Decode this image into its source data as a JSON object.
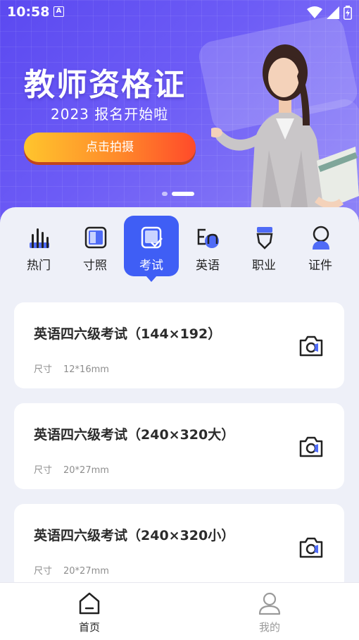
{
  "status": {
    "time": "10:58",
    "badge": "A"
  },
  "banner": {
    "title": "教师资格证",
    "subtitle": "2023 报名开始啦",
    "button": "点击拍摄"
  },
  "categories": [
    {
      "label": "热门",
      "icon": "bar-chart-icon",
      "active": false
    },
    {
      "label": "寸照",
      "icon": "photo-frame-icon",
      "active": false
    },
    {
      "label": "考试",
      "icon": "exam-check-icon",
      "active": true
    },
    {
      "label": "英语",
      "icon": "english-en-icon",
      "active": false
    },
    {
      "label": "职业",
      "icon": "badge-shield-icon",
      "active": false
    },
    {
      "label": "证件",
      "icon": "id-person-icon",
      "active": false
    }
  ],
  "items": [
    {
      "title": "英语四六级考试（144×192）",
      "size_label": "尺寸",
      "size": "12*16mm"
    },
    {
      "title": "英语四六级考试（240×320大）",
      "size_label": "尺寸",
      "size": "20*27mm"
    },
    {
      "title": "英语四六级考试（240×320小）",
      "size_label": "尺寸",
      "size": "20*27mm"
    }
  ],
  "nav": {
    "home": "首页",
    "me": "我的"
  },
  "colors": {
    "accent": "#3f5ef5",
    "banner": "#5b49f0"
  }
}
